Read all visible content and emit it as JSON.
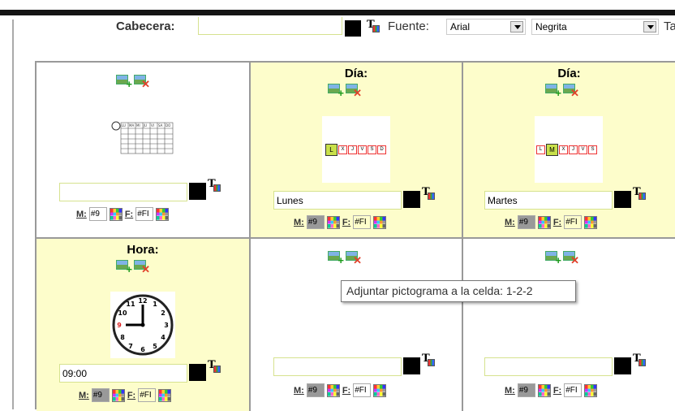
{
  "header": {
    "label": "Cabecera:",
    "value": "",
    "fuente_label": "Fuente:",
    "font_select": "Arial",
    "weight_select": "Negrita",
    "trailing": "Ta"
  },
  "cells": [
    {
      "title": "",
      "text": "",
      "m_label": "M:",
      "m_value": "#9",
      "f_label": "F:",
      "f_value": "#FI",
      "picto": "calendar-grid"
    },
    {
      "title": "Día:",
      "text": "Lunes",
      "m_label": "M:",
      "m_value": "#9",
      "f_label": "F:",
      "f_value": "#FI",
      "picto": "weekday-L"
    },
    {
      "title": "Día:",
      "text": "Martes",
      "m_label": "M:",
      "m_value": "#9",
      "f_label": "F:",
      "f_value": "#FI",
      "picto": "weekday-M"
    },
    {
      "title": "Hora:",
      "text": "09:00",
      "m_label": "M:",
      "m_value": "#9",
      "f_label": "F:",
      "f_value": "#FI",
      "picto": "clock"
    },
    {
      "title": "",
      "text": "",
      "m_label": "M:",
      "m_value": "#9",
      "f_label": "F:",
      "f_value": "#FI",
      "picto": ""
    },
    {
      "title": "",
      "text": "",
      "m_label": "M:",
      "m_value": "#9",
      "f_label": "F:",
      "f_value": "#FI",
      "picto": ""
    }
  ],
  "weekdays": [
    "L",
    "M",
    "X",
    "J",
    "V",
    "S",
    "D"
  ],
  "calendar_header": [
    "LU",
    "MA",
    "MI",
    "JU",
    "VI",
    "SA",
    "DO"
  ],
  "clock_numbers": [
    "12",
    "1",
    "2",
    "3",
    "4",
    "5",
    "6",
    "7",
    "8",
    "9",
    "10",
    "11"
  ],
  "tooltip": "Adjuntar pictograma a la celda: 1-2-2",
  "colors": {
    "cell_yellow": "#fdfdcb",
    "input_border": "#d6e28f",
    "weekday_active": "#c8e04a"
  }
}
